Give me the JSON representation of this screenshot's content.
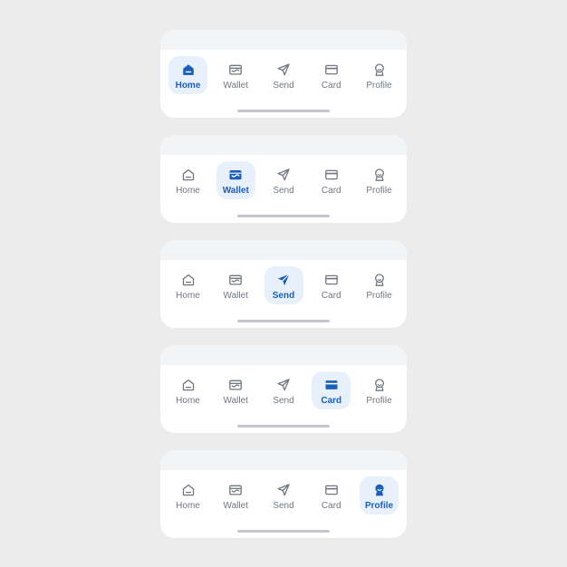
{
  "tabs": [
    {
      "id": "home",
      "label": "Home",
      "icon": "home-icon"
    },
    {
      "id": "wallet",
      "label": "Wallet",
      "icon": "wallet-icon"
    },
    {
      "id": "send",
      "label": "Send",
      "icon": "send-icon"
    },
    {
      "id": "card",
      "label": "Card",
      "icon": "card-icon"
    },
    {
      "id": "profile",
      "label": "Profile",
      "icon": "profile-icon"
    }
  ],
  "variants": [
    {
      "active": "home"
    },
    {
      "active": "wallet"
    },
    {
      "active": "send"
    },
    {
      "active": "card"
    },
    {
      "active": "profile"
    }
  ],
  "colors": {
    "background": "#ececec",
    "surface": "#ffffff",
    "accent": "#1c5fb8",
    "active_bg": "#e8f1fb",
    "inactive": "#707780",
    "indicator": "#c3c7cd"
  }
}
